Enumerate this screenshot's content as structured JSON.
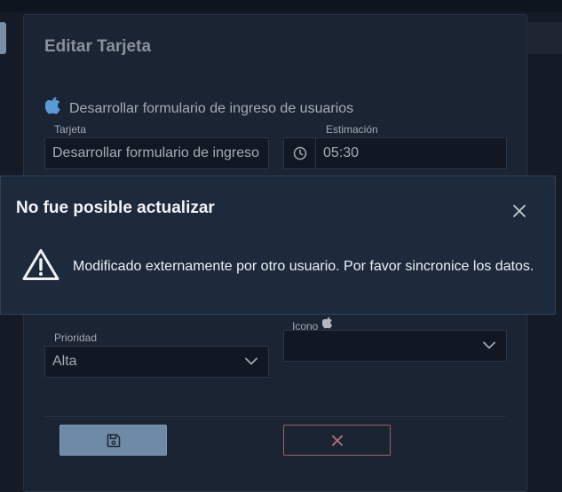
{
  "dialog": {
    "title": "Editar Tarjeta",
    "subtitle": "Desarrollar formulario de ingreso de usuarios",
    "fields": {
      "tarjeta": {
        "label": "Tarjeta",
        "value": "Desarrollar formulario de ingreso"
      },
      "estimacion": {
        "label": "Estimación",
        "value": "05:30"
      },
      "prioridad": {
        "label": "Prioridad",
        "value": "Alta"
      },
      "icono": {
        "label": "Icono",
        "value": ""
      }
    },
    "buttons": {
      "save_icon": "floppy-disk-icon",
      "cancel_icon": "x-icon"
    }
  },
  "alert": {
    "title": "No fue posible actualizar",
    "message": "Modificado externamente por otro usuario. Por favor sincronice los datos.",
    "icon": "warning-icon"
  },
  "colors": {
    "background": "#141b27",
    "modal": "#1b2432",
    "alert": "#1c2a3c",
    "save_button": "#6e8aa6",
    "cancel_border": "#9a6270",
    "apple_icon": "#5b9bd5"
  }
}
